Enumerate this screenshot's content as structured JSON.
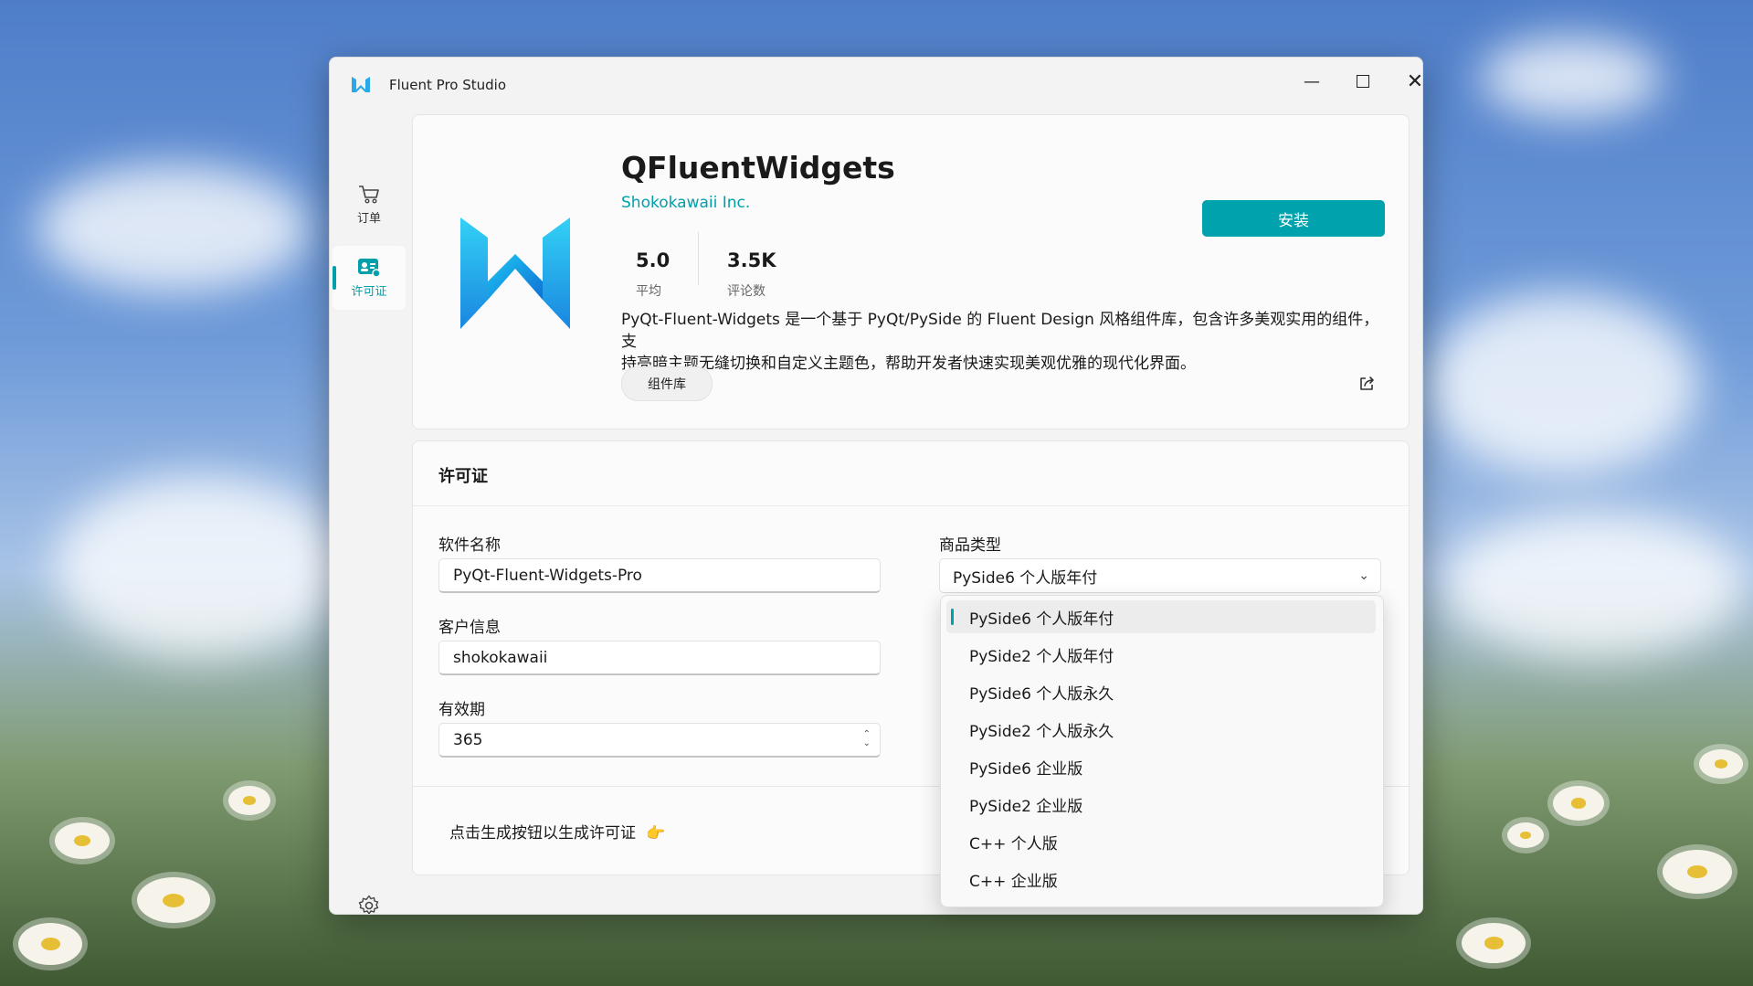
{
  "window": {
    "title": "Fluent Pro Studio",
    "controls": [
      "minimize",
      "maximize",
      "close"
    ]
  },
  "nav": {
    "items": [
      {
        "label": "订单",
        "icon": "cart-icon",
        "active": false
      },
      {
        "label": "许可证",
        "icon": "license-icon",
        "active": true
      }
    ],
    "settings": {
      "label": "设置",
      "icon": "gear-icon"
    }
  },
  "product": {
    "name": "QFluentWidgets",
    "publisher": "Shokokawaii Inc.",
    "install_label": "安装",
    "rating": {
      "value": "5.0",
      "label": "平均"
    },
    "reviews": {
      "value": "3.5K",
      "label": "评论数"
    },
    "description_line1": "PyQt-Fluent-Widgets 是一个基于 PyQt/PySide 的 Fluent Design 风格组件库，包含许多美观实用的组件，支",
    "description_line2": "持亮暗主题无缝切换和自定义主题色，帮助开发者快速实现美观优雅的现代化界面。",
    "tag": "组件库",
    "accent_color": "#009faa"
  },
  "license": {
    "section_title": "许可证",
    "software_name": {
      "label": "软件名称",
      "value": "PyQt-Fluent-Widgets-Pro"
    },
    "customer_info": {
      "label": "客户信息",
      "value": "shokokawaii"
    },
    "validity": {
      "label": "有效期",
      "value": "365"
    },
    "product_type": {
      "label": "商品类型",
      "value": "PySide6 个人版年付"
    },
    "hint": "点击生成按钮以生成许可证",
    "hint_emoji": "👉"
  },
  "dropdown": {
    "options": [
      "PySide6 个人版年付",
      "PySide2 个人版年付",
      "PySide6 个人版永久",
      "PySide2 个人版永久",
      "PySide6 企业版",
      "PySide2 企业版",
      "C++ 个人版",
      "C++ 企业版"
    ],
    "selected_index": 0
  }
}
